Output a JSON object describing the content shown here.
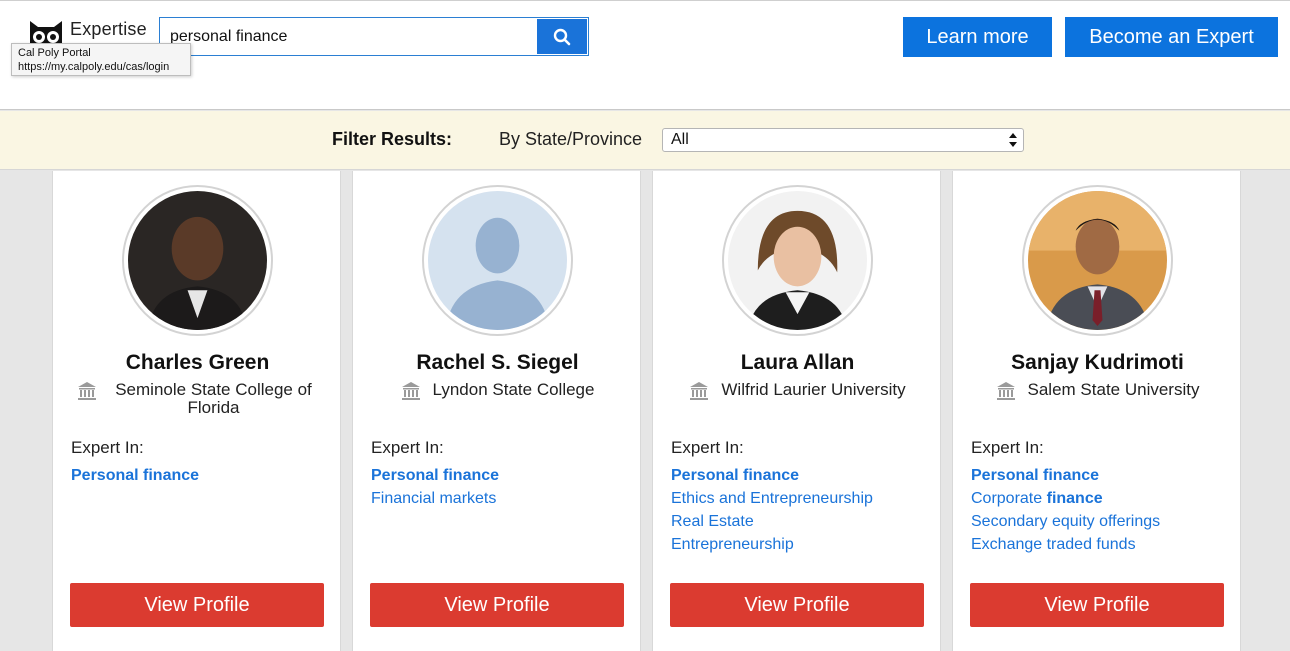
{
  "header": {
    "logo_text": "Expertise",
    "search": {
      "value": "personal finance",
      "placeholder": ""
    },
    "tooltip": {
      "title": "Cal Poly Portal",
      "url": "https://my.calpoly.edu/cas/login"
    },
    "learn_more_label": "Learn more",
    "become_expert_label": "Become an Expert"
  },
  "filter": {
    "label": "Filter Results:",
    "state_label": "By State/Province",
    "state_value": "All"
  },
  "experts": [
    {
      "name": "Charles Green",
      "institution": "Seminole State College of Florida",
      "expert_in_label": "Expert In:",
      "topics": [
        "Personal finance"
      ],
      "view_label": "View Profile"
    },
    {
      "name": "Rachel S. Siegel",
      "institution": "Lyndon State College",
      "expert_in_label": "Expert In:",
      "topics": [
        "Personal finance",
        "Financial markets"
      ],
      "view_label": "View Profile"
    },
    {
      "name": "Laura Allan",
      "institution": "Wilfrid Laurier University",
      "expert_in_label": "Expert In:",
      "topics": [
        "Personal finance",
        "Ethics and Entrepreneurship",
        "Real Estate",
        "Entrepreneurship"
      ],
      "view_label": "View Profile"
    },
    {
      "name": "Sanjay Kudrimoti",
      "institution": "Salem State University",
      "expert_in_label": "Expert In:",
      "topics": [
        "Personal finance",
        "Corporate",
        "finance",
        "Secondary equity offerings",
        "Exchange traded funds"
      ],
      "view_label": "View Profile"
    }
  ],
  "colors": {
    "accent_blue": "#0c73de",
    "link_blue": "#1a73d9",
    "view_button_red": "#db3b30",
    "filter_bg": "#faf6e3"
  }
}
